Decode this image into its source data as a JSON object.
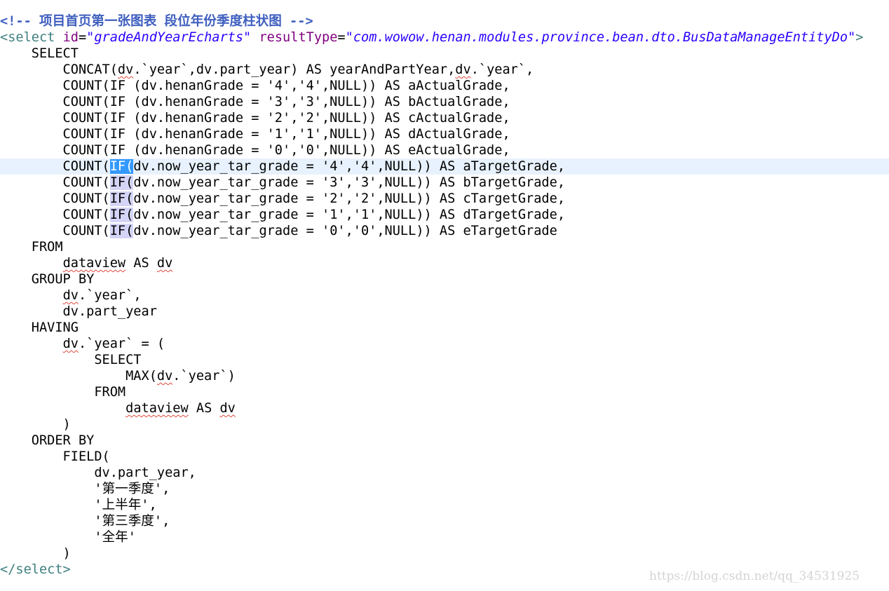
{
  "editor": {
    "lines": [
      "<!-- 项目首页第一张图表 段位年份季度柱状图 -->",
      "<select id=\"gradeAndYearEcharts\" resultType=\"com.wowow.henan.modules.province.bean.dto.BusDataManageEntityDo\">",
      "    SELECT",
      "        CONCAT(dv.`year`,dv.part_year) AS yearAndPartYear,dv.`year`,",
      "        COUNT(IF (dv.henanGrade = '4','4',NULL)) AS aActualGrade,",
      "        COUNT(IF (dv.henanGrade = '3','3',NULL)) AS bActualGrade,",
      "        COUNT(IF (dv.henanGrade = '2','2',NULL)) AS cActualGrade,",
      "        COUNT(IF (dv.henanGrade = '1','1',NULL)) AS dActualGrade,",
      "        COUNT(IF (dv.henanGrade = '0','0',NULL)) AS eActualGrade,",
      "        COUNT(IF(dv.now_year_tar_grade = '4','4',NULL)) AS aTargetGrade,",
      "        COUNT(IF(dv.now_year_tar_grade = '3','3',NULL)) AS bTargetGrade,",
      "        COUNT(IF(dv.now_year_tar_grade = '2','2',NULL)) AS cTargetGrade,",
      "        COUNT(IF(dv.now_year_tar_grade = '1','1',NULL)) AS dTargetGrade,",
      "        COUNT(IF(dv.now_year_tar_grade = '0','0',NULL)) AS eTargetGrade",
      "    FROM",
      "        dataview AS dv",
      "    GROUP BY",
      "        dv.`year`,",
      "        dv.part_year",
      "    HAVING",
      "        dv.`year` = (",
      "            SELECT",
      "                MAX(dv.`year`)",
      "            FROM",
      "                dataview AS dv",
      "        )",
      "    ORDER BY",
      "        FIELD(",
      "            dv.part_year,",
      "            '第一季度',",
      "            '上半年',",
      "            '第三季度',",
      "            '全年'",
      "        )",
      "</select>"
    ],
    "segments": {
      "l0": "<!-- 项目首页第一张图表 段位年份季度柱状图 -->",
      "l1_open": "<select",
      "l1_attr1": "id",
      "l1_eq1": "=",
      "l1_val1": "\"gradeAndYearEcharts\"",
      "l1_attr2": "resultType",
      "l1_eq2": "=",
      "l1_val2": "\"com.wowow.henan.modules.province.bean.dto.BusDataManageEntityDo\"",
      "l1_close": ">",
      "l3_a": "        CONCAT(",
      "l3_dv1": "dv",
      "l3_b": ".`year`,dv.part_year) AS yearAndPartYear,",
      "l3_dv2": "dv",
      "l3_c": ".`year`,",
      "l9_a": "        COUNT(",
      "l9_sel": "IF(",
      "l9_b": "dv.now_year_tar_grade = '4','4',NULL)) AS aTargetGrade,",
      "l10_a": "        COUNT(",
      "l10_occ": "IF(",
      "l10_b": "dv.now_year_tar_grade = '3','3',NULL)) AS bTargetGrade,",
      "l11_a": "        COUNT(",
      "l11_occ": "IF(",
      "l11_b": "dv.now_year_tar_grade = '2','2',NULL)) AS cTargetGrade,",
      "l12_a": "        COUNT(",
      "l12_occ": "IF(",
      "l12_b": "dv.now_year_tar_grade = '1','1',NULL)) AS dTargetGrade,",
      "l13_a": "        COUNT(",
      "l13_occ": "IF(",
      "l13_b": "dv.now_year_tar_grade = '0','0',NULL)) AS eTargetGrade",
      "l15_a": "        ",
      "l15_sq": "dataview",
      "l15_b": " AS ",
      "l15_sq2": "dv",
      "l17_a": "        ",
      "l17_sq": "dv",
      "l17_b": ".`year`,",
      "l20_a": "        ",
      "l20_sq": "dv",
      "l20_b": ".`year` = (",
      "l22_a": "                MAX(",
      "l22_sq": "dv",
      "l22_b": ".`year`)",
      "l24_a": "                ",
      "l24_sq": "dataview",
      "l24_b": " AS ",
      "l24_sq2": "dv",
      "l34_open": "</select>"
    }
  },
  "watermark": "https://blog.csdn.net/qq_34531925",
  "colors": {
    "comment": "#3f5fbf",
    "tag": "#3f7f7f",
    "attribute": "#7f007f",
    "string": "#2a00ff",
    "current_line": "#e8f2fe",
    "selection": "#3399ff",
    "occurrence": "#d4d4f7"
  }
}
